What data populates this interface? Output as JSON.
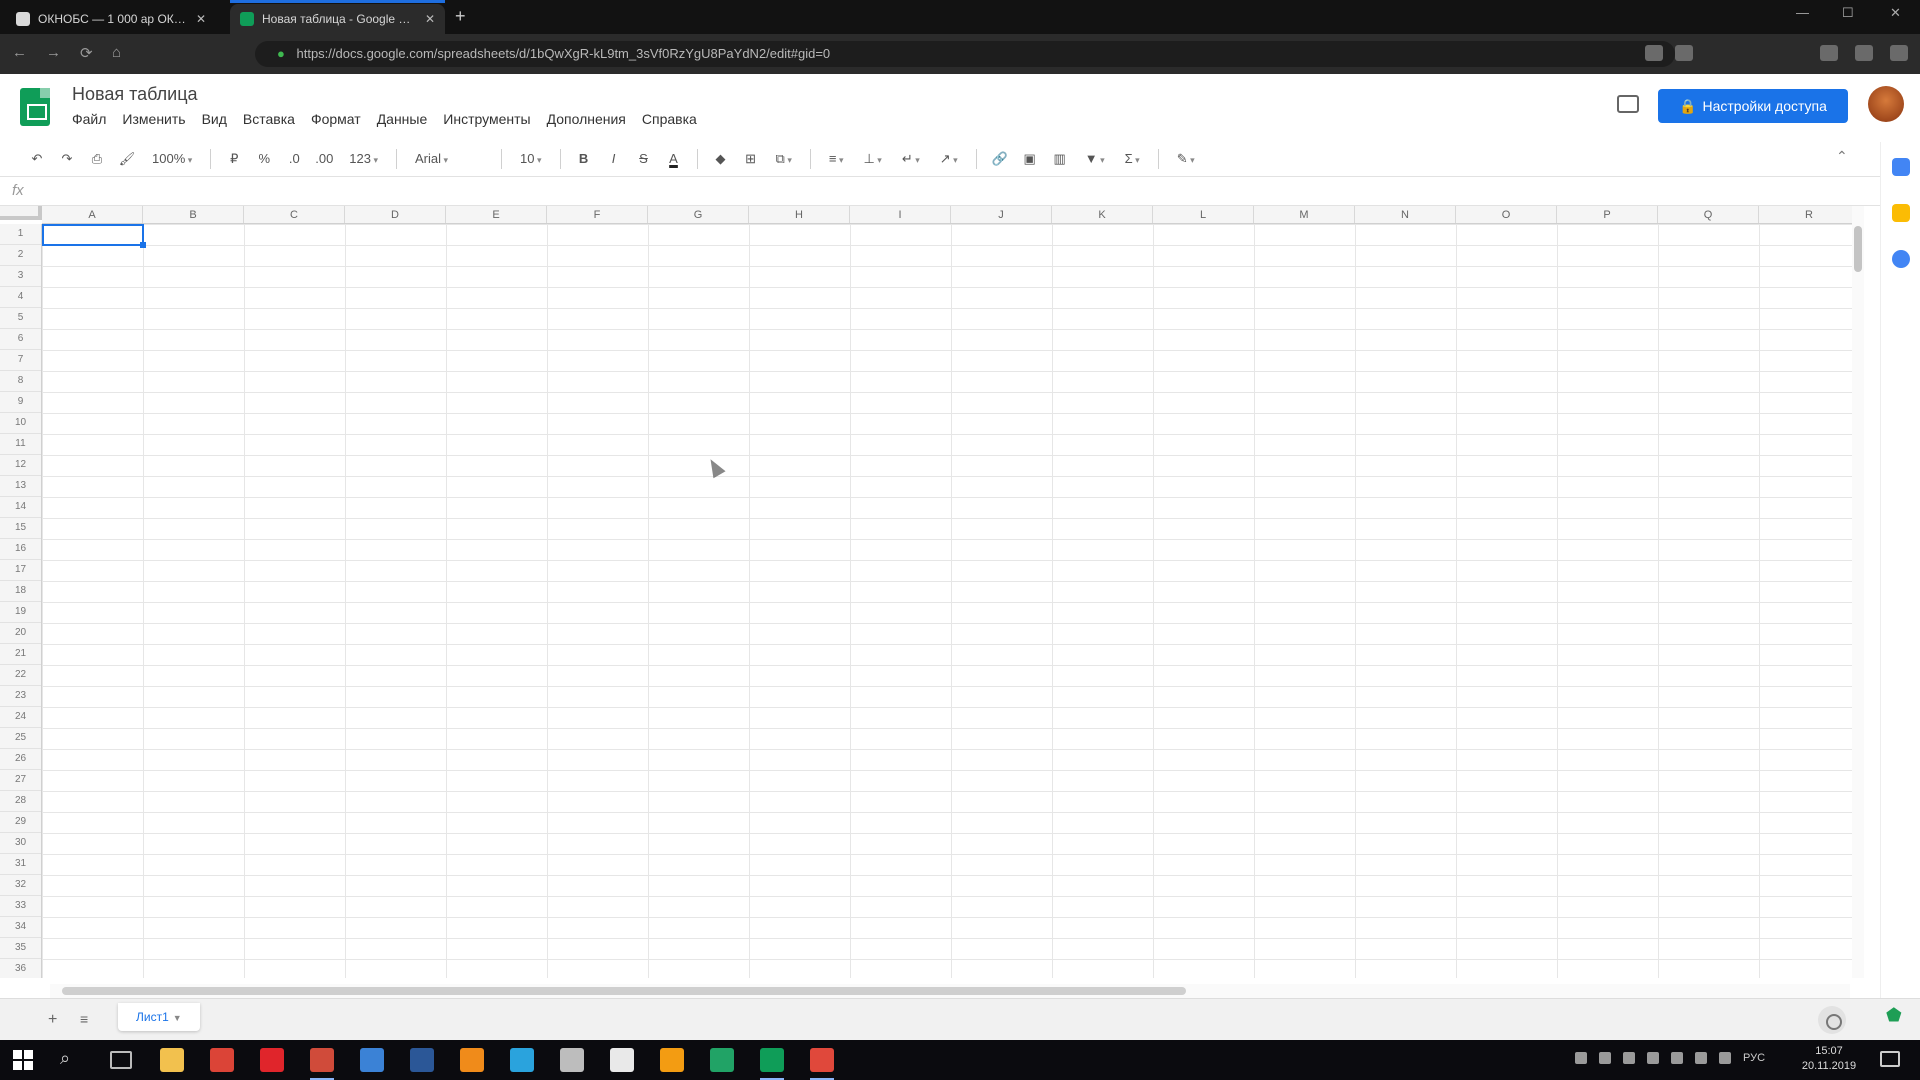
{
  "browser": {
    "tabs": [
      {
        "title": "ОКНОБС — 1 000 ар ОКТП...",
        "favicon_color": "#d9d9d9",
        "active": false
      },
      {
        "title": "Новая таблица - Google Та...",
        "favicon_color": "#0f9d58",
        "active": true
      }
    ],
    "new_tab_symbol": "+",
    "url": "https://docs.google.com/spreadsheets/d/1bQwXgR-kL9tm_3sVf0RzYgU8PaYdN2/edit#gid=0",
    "window_controls": {
      "minimize": "—",
      "maximize": "☐",
      "close": "✕"
    }
  },
  "nav": {
    "back": "←",
    "forward": "→",
    "reload": "⟳",
    "home": "⌂"
  },
  "document": {
    "title": "Новая таблица",
    "menu": [
      "Файл",
      "Изменить",
      "Вид",
      "Вставка",
      "Формат",
      "Данные",
      "Инструменты",
      "Дополнения",
      "Справка"
    ],
    "share_label": "Настройки доступа",
    "share_icon": "lock-icon"
  },
  "toolbar": {
    "undo": "↶",
    "redo": "↷",
    "print": "⎙",
    "paint": "🖌",
    "zoom": "100%",
    "currency": "₽",
    "percent": "%",
    "decimal_less": ".0",
    "decimal_more": ".00",
    "format_more": "123",
    "font": "Arial",
    "font_size": "10",
    "bold": "B",
    "italic": "I",
    "strike": "S",
    "text_color": "A",
    "fill": "◆",
    "borders": "⊞",
    "merge": "⧉",
    "halign": "≡",
    "valign": "⊥",
    "wrap": "↵",
    "rotate": "↗",
    "link": "🔗",
    "comment": "▣",
    "chart": "▥",
    "filter": "▼",
    "function": "Σ",
    "input_tools": "✎",
    "collapse": "⌃"
  },
  "formula_bar": {
    "fx": "fx",
    "value": ""
  },
  "grid": {
    "columns": [
      "A",
      "B",
      "C",
      "D",
      "E",
      "F",
      "G",
      "H",
      "I",
      "J",
      "K",
      "L",
      "M",
      "N",
      "O",
      "P",
      "Q",
      "R"
    ],
    "rows": [
      "1",
      "2",
      "3",
      "4",
      "5",
      "6",
      "7",
      "8",
      "9",
      "10",
      "11",
      "12",
      "13",
      "14",
      "15",
      "16",
      "17",
      "18",
      "19",
      "20",
      "21",
      "22",
      "23",
      "24",
      "25",
      "26",
      "27",
      "28",
      "29",
      "30",
      "31",
      "32",
      "33",
      "34",
      "35",
      "36"
    ],
    "selected_cell": "A1"
  },
  "side_panel": [
    {
      "name": "calendar-icon",
      "color": "#4285f4"
    },
    {
      "name": "keep-icon",
      "color": "#fbbc04"
    },
    {
      "name": "tasks-icon",
      "color": "#4285f4"
    }
  ],
  "sheets": {
    "add_symbol": "+",
    "list_symbol": "≡",
    "tabs": [
      "Лист1"
    ]
  },
  "taskbar": {
    "apps": [
      {
        "name": "file-explorer-icon",
        "color": "#f2c14e",
        "running": false
      },
      {
        "name": "chrome-icon",
        "color": "#db4437",
        "running": false
      },
      {
        "name": "opera-icon",
        "color": "#e0252b",
        "running": false
      },
      {
        "name": "yandex-browser-icon",
        "color": "#d04b3a",
        "running": true
      },
      {
        "name": "mail-icon",
        "color": "#3b82d6",
        "running": false
      },
      {
        "name": "word-icon",
        "color": "#2b5797",
        "running": false
      },
      {
        "name": "vlc-icon",
        "color": "#f08b1a",
        "running": false
      },
      {
        "name": "telegram-icon",
        "color": "#2aa3dd",
        "running": false
      },
      {
        "name": "camera-icon",
        "color": "#bdbdbd",
        "running": false
      },
      {
        "name": "notepad-icon",
        "color": "#e9e9e9",
        "running": false
      },
      {
        "name": "app-orange-icon",
        "color": "#f39c12",
        "running": false
      },
      {
        "name": "excel-icon",
        "color": "#21a366",
        "running": false
      },
      {
        "name": "sheets-icon",
        "color": "#0f9d58",
        "running": true
      },
      {
        "name": "slides-icon",
        "color": "#e0483b",
        "running": true
      }
    ],
    "clock_time": "15:07",
    "clock_date": "20.11.2019",
    "language": "РУС"
  }
}
